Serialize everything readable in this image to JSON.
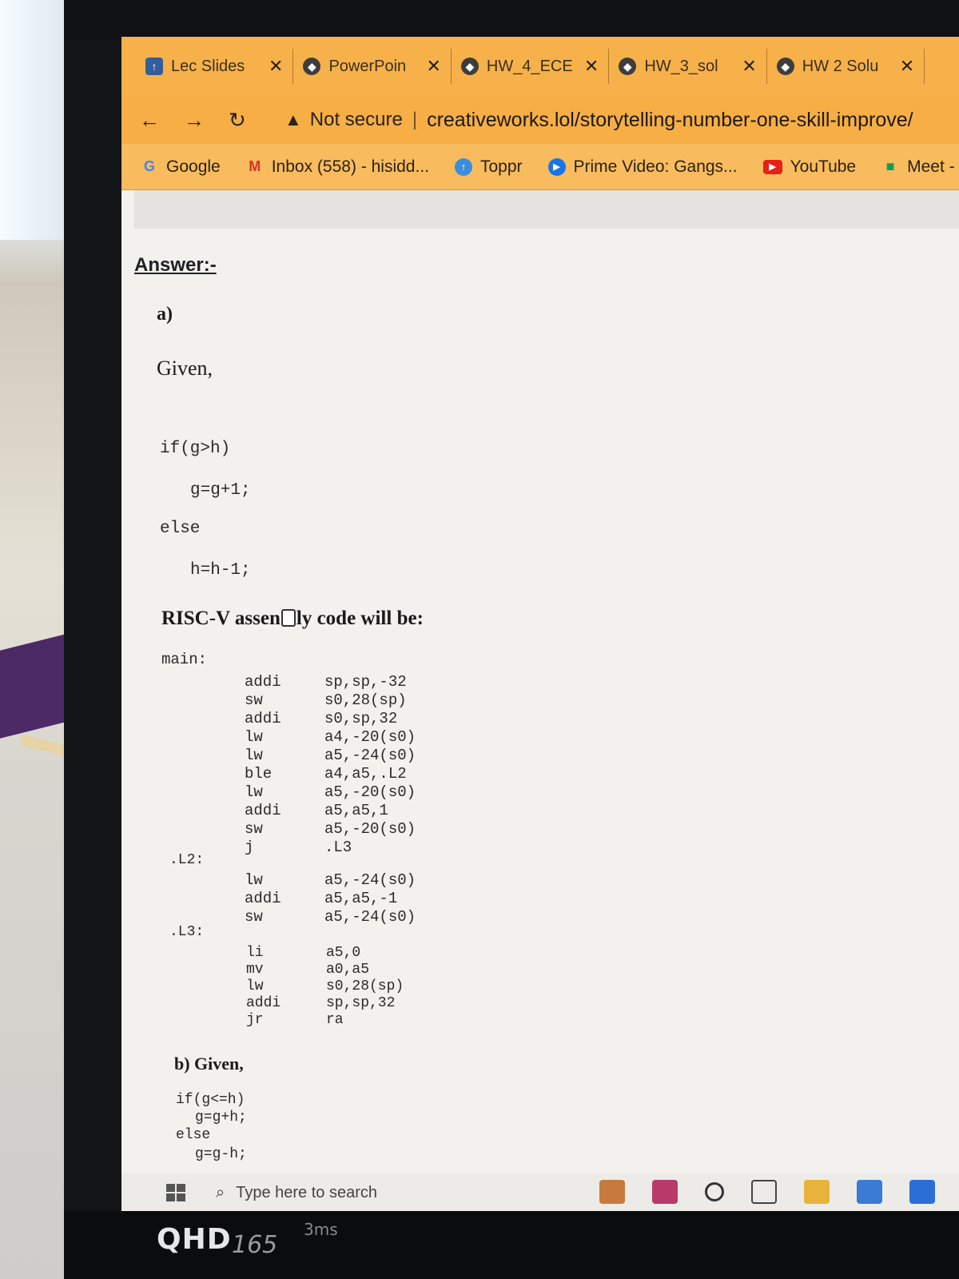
{
  "tabs": [
    {
      "title": "Lec Slides",
      "icon": "pin-icon"
    },
    {
      "title": "PowerPoin",
      "icon": "globe-icon"
    },
    {
      "title": "HW_4_ECE",
      "icon": "globe-icon"
    },
    {
      "title": "HW_3_sol",
      "icon": "globe-icon"
    },
    {
      "title": "HW 2 Solu",
      "icon": "globe-icon"
    }
  ],
  "tab_close": "✕",
  "address": {
    "warning": "Not secure",
    "url": "creativeworks.lol/storytelling-number-one-skill-improve/"
  },
  "bookmarks": [
    {
      "label": "Google",
      "icon": "google-icon"
    },
    {
      "label": "Inbox (558) - hisidd...",
      "icon": "gmail-icon"
    },
    {
      "label": "Toppr",
      "icon": "toppr-icon"
    },
    {
      "label": "Prime Video: Gangs...",
      "icon": "prime-video-icon"
    },
    {
      "label": "YouTube",
      "icon": "youtube-icon"
    },
    {
      "label": "Meet -",
      "icon": "meet-icon"
    }
  ],
  "content": {
    "answer_heading": "Answer:-",
    "part_a": "a)",
    "given": "Given,",
    "code_a": [
      "if(g>h)",
      "g=g+1;",
      "else",
      "h=h-1;"
    ],
    "riscv_before": "RISC-V assen",
    "riscv_after": "ly code will be:",
    "main_label": "main:",
    "main_block": [
      {
        "op": "addi",
        "args": "sp,sp,-32"
      },
      {
        "op": "sw",
        "args": "s0,28(sp)"
      },
      {
        "op": "addi",
        "args": "s0,sp,32"
      },
      {
        "op": "lw",
        "args": "a4,-20(s0)"
      },
      {
        "op": "lw",
        "args": "a5,-24(s0)"
      },
      {
        "op": "ble",
        "args": "a4,a5,.L2"
      },
      {
        "op": "lw",
        "args": "a5,-20(s0)"
      },
      {
        "op": "addi",
        "args": "a5,a5,1"
      },
      {
        "op": "sw",
        "args": "a5,-20(s0)"
      },
      {
        "op": "j",
        "args": ".L3"
      }
    ],
    "l2_label": ".L2:",
    "l2_block": [
      {
        "op": "lw",
        "args": "a5,-24(s0)"
      },
      {
        "op": "addi",
        "args": "a5,a5,-1"
      },
      {
        "op": "sw",
        "args": "a5,-24(s0)"
      }
    ],
    "l3_label": ".L3:",
    "l3_block": [
      {
        "op": "li",
        "args": "a5,0"
      },
      {
        "op": "mv",
        "args": "a0,a5"
      },
      {
        "op": "lw",
        "args": "s0,28(sp)"
      },
      {
        "op": "addi",
        "args": "sp,sp,32"
      },
      {
        "op": "jr",
        "args": "ra"
      }
    ],
    "part_b": "b) Given,",
    "code_b": [
      "if(g<=h)",
      "g=g+h;",
      "else",
      "g=g-h;"
    ]
  },
  "taskbar": {
    "search_placeholder": "Type here to search"
  },
  "monitor": {
    "badge": "QHD",
    "hz": "165",
    "ms": "3ms"
  }
}
